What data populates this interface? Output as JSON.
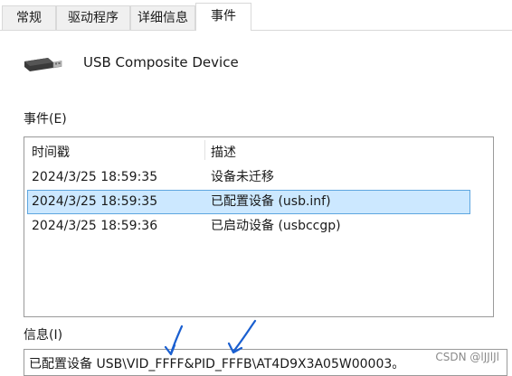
{
  "tabs": [
    "常规",
    "驱动程序",
    "详细信息",
    "事件"
  ],
  "active_tab": "事件",
  "device": {
    "icon": "usb-device-icon",
    "name": "USB Composite Device"
  },
  "events": {
    "label": "事件(E)",
    "columns": {
      "timestamp": "时间戳",
      "description": "描述"
    },
    "rows": [
      {
        "timestamp": "2024/3/25 18:59:35",
        "description": "设备未迁移",
        "selected": false
      },
      {
        "timestamp": "2024/3/25 18:59:35",
        "description": "已配置设备 (usb.inf)",
        "selected": true
      },
      {
        "timestamp": "2024/3/25 18:59:36",
        "description": "已启动设备 (usbccgp)",
        "selected": false
      }
    ]
  },
  "info": {
    "label": "信息(I)",
    "text": "已配置设备 USB\\VID_FFFF&PID_FFFB\\AT4D9X3A05W00003。"
  },
  "annotations": {
    "arrow_color": "#1a5fd0",
    "arrow_count": 2
  },
  "watermark": "CSDN @lJJlJl",
  "colors": {
    "selection_fill": "#cce8ff",
    "selection_border": "#5ea6e0"
  }
}
